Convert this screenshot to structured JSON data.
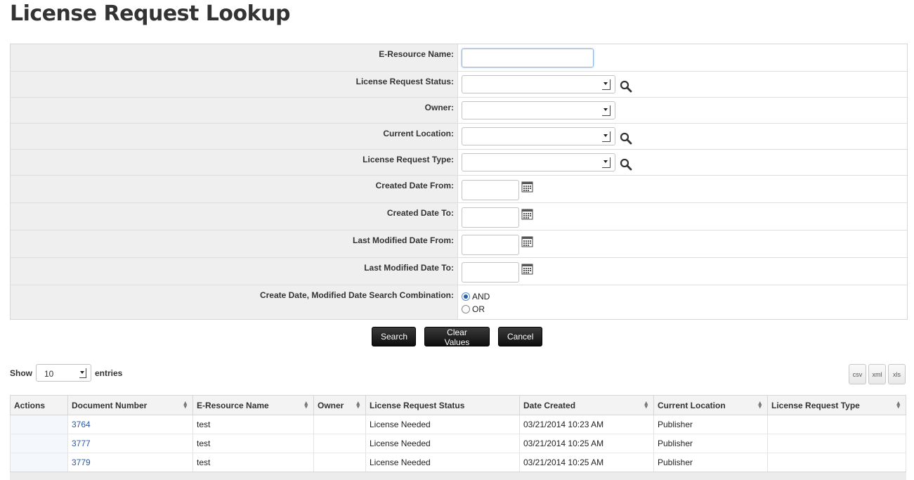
{
  "page": {
    "title": "License Request Lookup"
  },
  "form": {
    "fields": [
      {
        "label": "E-Resource Name:",
        "type": "text",
        "value": ""
      },
      {
        "label": "License Request Status:",
        "type": "select",
        "value": "",
        "lookup": true
      },
      {
        "label": "Owner:",
        "type": "select",
        "value": "",
        "lookup": false
      },
      {
        "label": "Current Location:",
        "type": "select",
        "value": "",
        "lookup": true
      },
      {
        "label": "License Request Type:",
        "type": "select",
        "value": "",
        "lookup": true
      },
      {
        "label": "Created Date From:",
        "type": "date",
        "value": ""
      },
      {
        "label": "Created Date To:",
        "type": "date",
        "value": ""
      },
      {
        "label": "Last Modified Date From:",
        "type": "date",
        "value": ""
      },
      {
        "label": "Last Modified Date To:",
        "type": "date",
        "value": ""
      }
    ],
    "combination": {
      "label": "Create Date, Modified Date Search Combination:",
      "options": [
        "AND",
        "OR"
      ],
      "selected": "AND"
    }
  },
  "buttons": {
    "search": "Search",
    "clear": "Clear Values",
    "cancel": "Cancel"
  },
  "table_controls": {
    "show_label": "Show",
    "entries_value": "10",
    "entries_label": "entries",
    "exports": [
      "csv",
      "xml",
      "xls"
    ]
  },
  "table": {
    "columns": [
      "Actions",
      "Document Number",
      "E-Resource Name",
      "Owner",
      "License Request Status",
      "Date Created",
      "Current Location",
      "License Request Type"
    ],
    "rows": [
      {
        "actions": "",
        "document_number": "3764",
        "e_resource_name": "test",
        "owner": "",
        "status": "License Needed",
        "date_created": "03/21/2014 10:23 AM",
        "current_location": "Publisher",
        "type": ""
      },
      {
        "actions": "",
        "document_number": "3777",
        "e_resource_name": "test",
        "owner": "",
        "status": "License Needed",
        "date_created": "03/21/2014 10:25 AM",
        "current_location": "Publisher",
        "type": ""
      },
      {
        "actions": "",
        "document_number": "3779",
        "e_resource_name": "test",
        "owner": "",
        "status": "License Needed",
        "date_created": "03/21/2014 10:25 AM",
        "current_location": "Publisher",
        "type": ""
      }
    ]
  },
  "colors": {
    "link": "#2659a6",
    "label_bg": "#efefef",
    "button_bg": "#1a1a1a"
  },
  "icons": {
    "lookup": "magnifier-icon",
    "calendar": "calendar-icon",
    "sort": "sort-icon"
  }
}
